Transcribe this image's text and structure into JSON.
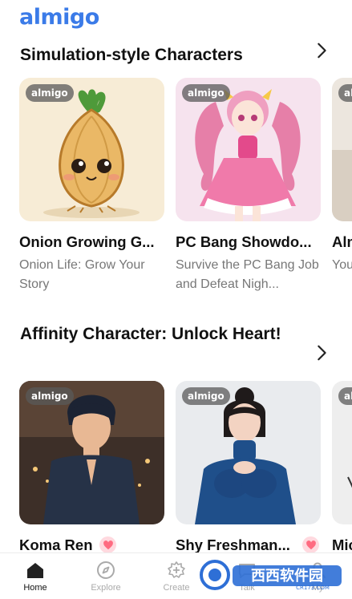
{
  "app": {
    "logo": "almigo"
  },
  "sections": [
    {
      "title": "Simulation-style Characters",
      "cards": [
        {
          "badge": "almigo",
          "title": "Onion Growing G...",
          "desc": "Onion Life: Grow Your Story"
        },
        {
          "badge": "almigo",
          "title": "PC Bang Showdo...",
          "desc": "Survive the PC Bang Job and Defeat Nigh..."
        },
        {
          "badge": "almigo",
          "title": "Alm",
          "desc": "You frie"
        }
      ]
    },
    {
      "title": "Affinity Character: Unlock Heart!",
      "cards": [
        {
          "badge": "almigo",
          "title": "Koma Ren"
        },
        {
          "badge": "almigo",
          "title": "Shy Freshman..."
        },
        {
          "badge": "almigo",
          "title": "Mic"
        }
      ]
    }
  ],
  "tabbar": {
    "tabs": [
      {
        "label": "Home",
        "icon": "home-icon",
        "active": true
      },
      {
        "label": "Explore",
        "icon": "compass-icon",
        "active": false
      },
      {
        "label": "Create",
        "icon": "create-icon",
        "active": false
      },
      {
        "label": "Talk",
        "icon": "chat-icon",
        "active": false
      },
      {
        "label": "My",
        "icon": "profile-icon",
        "active": false
      }
    ]
  },
  "watermark": {
    "text": "西西软件园",
    "sub": "CR173.COM"
  },
  "colors": {
    "brand": "#3b7be8",
    "heart": "#ff6b81",
    "muted": "#777777"
  }
}
